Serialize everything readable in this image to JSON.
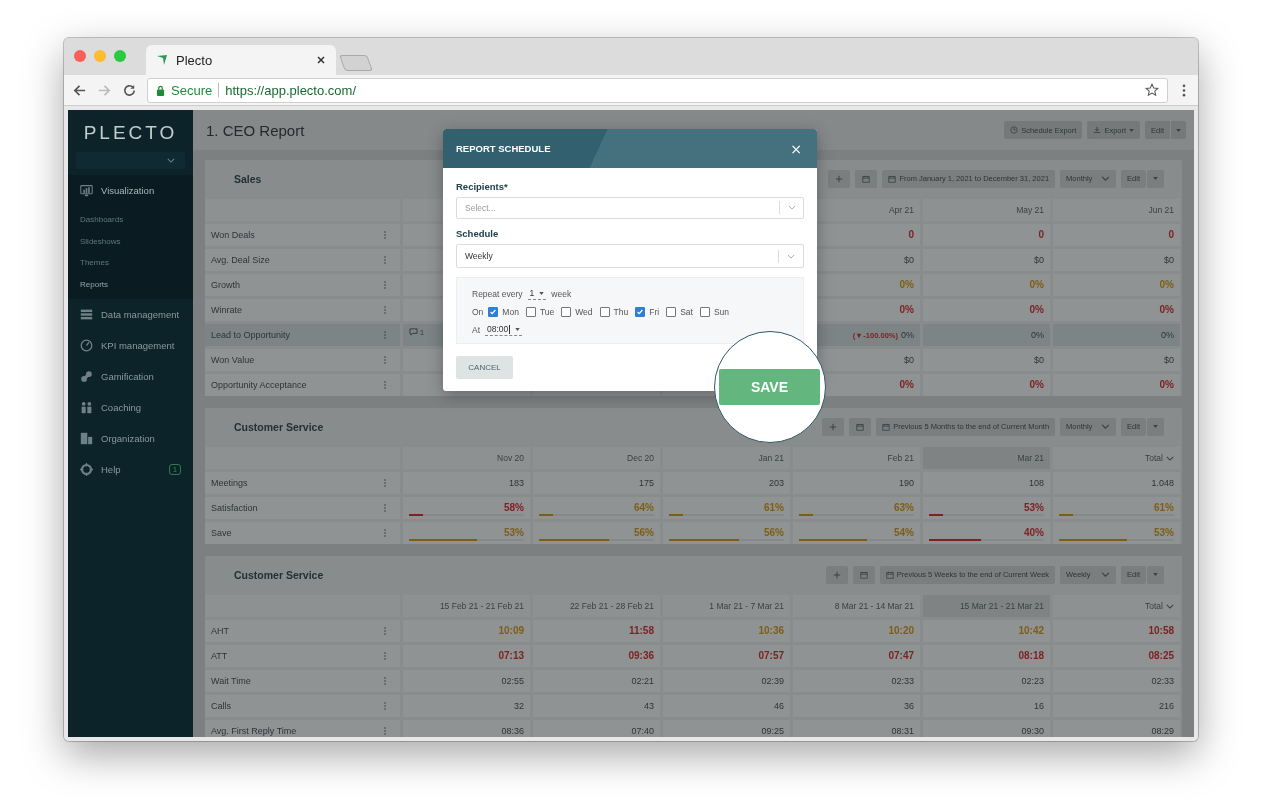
{
  "browser": {
    "tab_title": "Plecto",
    "secure": "Secure",
    "url": "https://app.plecto.com/"
  },
  "sidebar": {
    "logo": "PLECTO",
    "help_badge": "1",
    "items": [
      {
        "label": "Visualization",
        "kind": "chart",
        "selected": true,
        "children": [
          {
            "label": "Dashboards",
            "selected": false
          },
          {
            "label": "Slideshows",
            "selected": false
          },
          {
            "label": "Themes",
            "selected": false
          },
          {
            "label": "Reports",
            "selected": true
          }
        ]
      },
      {
        "label": "Data management",
        "kind": "database",
        "selected": false
      },
      {
        "label": "KPI management",
        "kind": "gauge",
        "selected": false
      },
      {
        "label": "Gamification",
        "kind": "puzzle",
        "selected": false
      },
      {
        "label": "Coaching",
        "kind": "people",
        "selected": false
      },
      {
        "label": "Organization",
        "kind": "building",
        "selected": false
      },
      {
        "label": "Help",
        "kind": "lifebuoy",
        "selected": false
      }
    ]
  },
  "report": {
    "title": "1. CEO Report",
    "actions": [
      {
        "label": "Schedule Export",
        "kind": "schedule"
      },
      {
        "label": "Export",
        "kind": "export"
      },
      {
        "label": "Edit",
        "kind": "split"
      }
    ]
  },
  "cards": [
    {
      "title": "Sales",
      "range": "From January 1, 2021 to December 31, 2021",
      "period": "Monthly",
      "edit": "Edit",
      "columns": [
        {
          "label": "Apr 21",
          "highlighted": false,
          "menu": false
        },
        {
          "label": "May 21",
          "highlighted": false,
          "menu": false
        },
        {
          "label": "Jun 21",
          "highlighted": false,
          "menu": false
        }
      ],
      "rows": [
        {
          "label": "Won Deals",
          "selected": false,
          "cells": [
            {
              "text": "0",
              "color": "#7d2222"
            },
            {
              "text": "0",
              "color": "#7d2222"
            },
            {
              "text": "0",
              "color": "#7d2222"
            }
          ]
        },
        {
          "label": "Avg. Deal Size",
          "selected": false,
          "cells": [
            {
              "text": "$0"
            },
            {
              "text": "$0"
            },
            {
              "text": "$0"
            }
          ]
        },
        {
          "label": "Growth",
          "selected": false,
          "cells": [
            {
              "text": "0%",
              "color": "#7d5e14"
            },
            {
              "text": "0%",
              "color": "#7d5e14"
            },
            {
              "text": "0%",
              "color": "#7d5e14"
            }
          ]
        },
        {
          "label": "Winrate",
          "selected": false,
          "cells": [
            {
              "text": "0%",
              "color": "#7d2222"
            },
            {
              "text": "0%",
              "color": "#7d2222"
            },
            {
              "text": "0%",
              "color": "#7d2222"
            }
          ]
        },
        {
          "label": "Lead to Opportunity",
          "selected": true,
          "comments": "1",
          "cells": [
            {
              "text": "0%",
              "note": "( ▾ -100.00%)"
            },
            {
              "text": "0%"
            },
            {
              "text": "0%"
            }
          ]
        },
        {
          "label": "Won Value",
          "selected": false,
          "cells": [
            {
              "text": "$0"
            },
            {
              "text": "$0"
            },
            {
              "text": "$0"
            }
          ]
        },
        {
          "label": "Opportunity Acceptance",
          "selected": false,
          "cells": [
            {
              "text": "0%",
              "color": "#7d2222"
            },
            {
              "text": "0%",
              "color": "#7d2222"
            },
            {
              "text": "0%",
              "color": "#7d2222"
            }
          ]
        }
      ]
    },
    {
      "title": "Customer Service",
      "range": "Previous 5 Months to the end of Current Month",
      "period": "Monthly",
      "edit": "Edit",
      "columns": [
        {
          "label": "Nov 20",
          "highlighted": false,
          "menu": false
        },
        {
          "label": "Dec 20",
          "highlighted": false,
          "menu": false
        },
        {
          "label": "Jan 21",
          "highlighted": false,
          "menu": false
        },
        {
          "label": "Feb 21",
          "highlighted": false,
          "menu": false
        },
        {
          "label": "Mar 21",
          "highlighted": true,
          "menu": false
        },
        {
          "label": "Total",
          "highlighted": false,
          "menu": true
        }
      ],
      "rows": [
        {
          "label": "Meetings",
          "selected": false,
          "cells": [
            {
              "text": "183"
            },
            {
              "text": "175"
            },
            {
              "text": "203"
            },
            {
              "text": "190"
            },
            {
              "text": "108"
            },
            {
              "text": "1.048"
            }
          ]
        },
        {
          "label": "Satisfaction",
          "selected": false,
          "cells": [
            {
              "text": "58%",
              "color": "#7d2222",
              "level": 0.12
            },
            {
              "text": "64%",
              "color": "#7d5e14",
              "level": 0.12
            },
            {
              "text": "61%",
              "color": "#7d5e14",
              "level": 0.12
            },
            {
              "text": "63%",
              "color": "#7d5e14",
              "level": 0.12
            },
            {
              "text": "53%",
              "color": "#7d2222",
              "level": 0.12
            },
            {
              "text": "61%",
              "color": "#7d5e14",
              "level": 0.12
            }
          ]
        },
        {
          "label": "Save",
          "selected": false,
          "cells": [
            {
              "text": "53%",
              "color": "#7d5e14",
              "level": 0.59
            },
            {
              "text": "56%",
              "color": "#7d5e14",
              "level": 0.61
            },
            {
              "text": "56%",
              "color": "#7d5e14",
              "level": 0.61
            },
            {
              "text": "54%",
              "color": "#7d5e14",
              "level": 0.59
            },
            {
              "text": "40%",
              "color": "#7d2222",
              "level": 0.45
            },
            {
              "text": "53%",
              "color": "#7d5e14",
              "level": 0.59
            }
          ]
        }
      ]
    },
    {
      "title": "Customer Service",
      "range": "Previous 5 Weeks to the end of Current Week",
      "period": "Weekly",
      "edit": "Edit",
      "columns": [
        {
          "label": "15 Feb 21 - 21 Feb 21",
          "highlighted": false,
          "menu": false
        },
        {
          "label": "22 Feb 21 - 28 Feb 21",
          "highlighted": false,
          "menu": false
        },
        {
          "label": "1 Mar 21 - 7 Mar 21",
          "highlighted": false,
          "menu": false
        },
        {
          "label": "8 Mar 21 - 14 Mar 21",
          "highlighted": false,
          "menu": false
        },
        {
          "label": "15 Mar 21 - 21 Mar 21",
          "highlighted": true,
          "menu": false
        },
        {
          "label": "Total",
          "highlighted": false,
          "menu": true
        }
      ],
      "rows": [
        {
          "label": "AHT",
          "selected": false,
          "cells": [
            {
              "text": "10:09",
              "color": "#7d5e14"
            },
            {
              "text": "11:58",
              "color": "#7d2222"
            },
            {
              "text": "10:36",
              "color": "#7d5e14"
            },
            {
              "text": "10:20",
              "color": "#7d5e14"
            },
            {
              "text": "10:42",
              "color": "#7d5e14"
            },
            {
              "text": "10:58",
              "color": "#7d2222"
            }
          ]
        },
        {
          "label": "ATT",
          "selected": false,
          "cells": [
            {
              "text": "07:13",
              "color": "#7d2222"
            },
            {
              "text": "09:36",
              "color": "#7d2222"
            },
            {
              "text": "07:57",
              "color": "#7d2222"
            },
            {
              "text": "07:47",
              "color": "#7d2222"
            },
            {
              "text": "08:18",
              "color": "#7d2222"
            },
            {
              "text": "08:25",
              "color": "#7d2222"
            }
          ]
        },
        {
          "label": "Wait Time",
          "selected": false,
          "cells": [
            {
              "text": "02:55"
            },
            {
              "text": "02:21"
            },
            {
              "text": "02:39"
            },
            {
              "text": "02:33"
            },
            {
              "text": "02:23"
            },
            {
              "text": "02:33"
            }
          ]
        },
        {
          "label": "Calls",
          "selected": false,
          "cells": [
            {
              "text": "32"
            },
            {
              "text": "43"
            },
            {
              "text": "46"
            },
            {
              "text": "36"
            },
            {
              "text": "16"
            },
            {
              "text": "216"
            }
          ]
        },
        {
          "label": "Avg. First Reply Time",
          "selected": false,
          "cells": [
            {
              "text": "08:36"
            },
            {
              "text": "07:40"
            },
            {
              "text": "09:25"
            },
            {
              "text": "08:31"
            },
            {
              "text": "09:30"
            },
            {
              "text": "08:29"
            }
          ]
        }
      ]
    }
  ],
  "modal": {
    "title": "REPORT SCHEDULE",
    "close": "×",
    "recipients": {
      "label": "Recipients*",
      "placeholder": "Select..."
    },
    "schedule": {
      "label": "Schedule",
      "value": "Weekly"
    },
    "repeat": {
      "prefix": "Repeat every",
      "value": "1",
      "suffix": "week"
    },
    "on_label": "On",
    "days": [
      {
        "label": "Mon",
        "checked": true
      },
      {
        "label": "Tue",
        "checked": false
      },
      {
        "label": "Wed",
        "checked": false
      },
      {
        "label": "Thu",
        "checked": false
      },
      {
        "label": "Fri",
        "checked": true
      },
      {
        "label": "Sat",
        "checked": false
      },
      {
        "label": "Sun",
        "checked": false
      }
    ],
    "at": {
      "label": "At",
      "value": "08:00"
    },
    "cancel": "CANCEL",
    "save": "SAVE"
  }
}
